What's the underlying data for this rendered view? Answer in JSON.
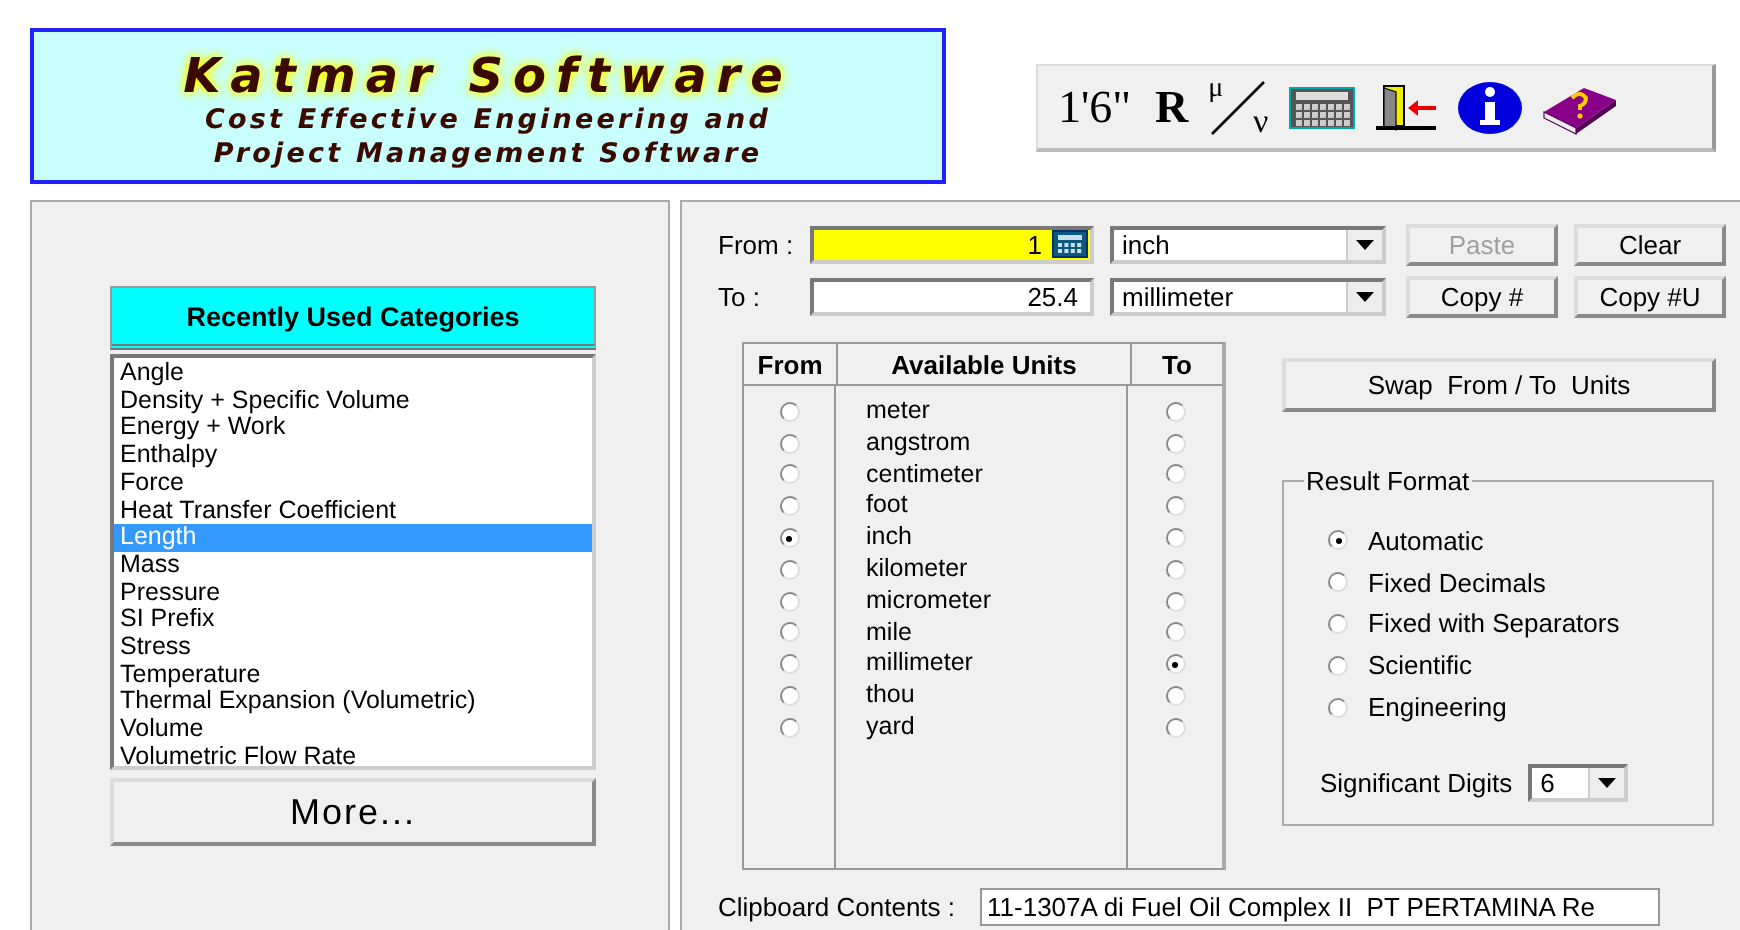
{
  "logo": {
    "title": "Katmar Software",
    "subtitle_lines": [
      "Cost Effective Engineering and",
      "Project Management Software"
    ]
  },
  "toolbar": {
    "glyph_buttons": [
      "1'6\"",
      "R"
    ],
    "ratio_button": {
      "top": "μ",
      "bottom": "ν"
    },
    "icon_buttons": [
      {
        "kind": "calculator"
      },
      {
        "kind": "exit"
      },
      {
        "kind": "info"
      },
      {
        "kind": "help"
      }
    ]
  },
  "categories": {
    "header": "Recently Used Categories",
    "items": [
      {
        "label": "Angle",
        "selected": false
      },
      {
        "label": "Density + Specific Volume",
        "selected": false
      },
      {
        "label": "Energy + Work",
        "selected": false
      },
      {
        "label": "Enthalpy",
        "selected": false
      },
      {
        "label": "Force",
        "selected": false
      },
      {
        "label": "Heat Transfer Coefficient",
        "selected": false
      },
      {
        "label": "Length",
        "selected": true
      },
      {
        "label": "Mass",
        "selected": false
      },
      {
        "label": "Pressure",
        "selected": false
      },
      {
        "label": "SI Prefix",
        "selected": false
      },
      {
        "label": "Stress",
        "selected": false
      },
      {
        "label": "Temperature",
        "selected": false
      },
      {
        "label": "Thermal Expansion (Volumetric)",
        "selected": false
      },
      {
        "label": "Volume",
        "selected": false
      },
      {
        "label": "Volumetric Flow Rate",
        "selected": false
      }
    ],
    "more_button": "More..."
  },
  "from": {
    "label": "From :",
    "value": "1",
    "unit": "inch"
  },
  "to": {
    "label": "To :",
    "value": "25.4",
    "unit": "millimeter"
  },
  "buttons": [
    {
      "label": "Paste",
      "disabled": true
    },
    {
      "label": "Clear",
      "disabled": false
    },
    {
      "label": "Copy #",
      "disabled": false
    },
    {
      "label": "Copy #U",
      "disabled": false
    }
  ],
  "units": {
    "columns": [
      "From",
      "Available Units",
      "To"
    ],
    "rows": [
      {
        "name": "meter",
        "from": false,
        "to": false
      },
      {
        "name": "angstrom",
        "from": false,
        "to": false
      },
      {
        "name": "centimeter",
        "from": false,
        "to": false
      },
      {
        "name": "foot",
        "from": false,
        "to": false
      },
      {
        "name": "inch",
        "from": true,
        "to": false
      },
      {
        "name": "kilometer",
        "from": false,
        "to": false
      },
      {
        "name": "micrometer",
        "from": false,
        "to": false
      },
      {
        "name": "mile",
        "from": false,
        "to": false
      },
      {
        "name": "millimeter",
        "from": false,
        "to": true
      },
      {
        "name": "thou",
        "from": false,
        "to": false
      },
      {
        "name": "yard",
        "from": false,
        "to": false
      }
    ]
  },
  "swap_button": "Swap  From / To  Units",
  "result_format": {
    "title": "Result Format",
    "options": [
      {
        "label": "Automatic",
        "selected": true
      },
      {
        "label": "Fixed Decimals",
        "selected": false
      },
      {
        "label": "Fixed with Separators",
        "selected": false
      },
      {
        "label": "Scientific",
        "selected": false
      },
      {
        "label": "Engineering",
        "selected": false
      }
    ],
    "digits_label": "Significant Digits",
    "digits_value": "6"
  },
  "clipboard": {
    "label": "Clipboard Contents :",
    "value": "11-1307A di Fuel Oil Complex II  PT PERTAMINA Re"
  }
}
